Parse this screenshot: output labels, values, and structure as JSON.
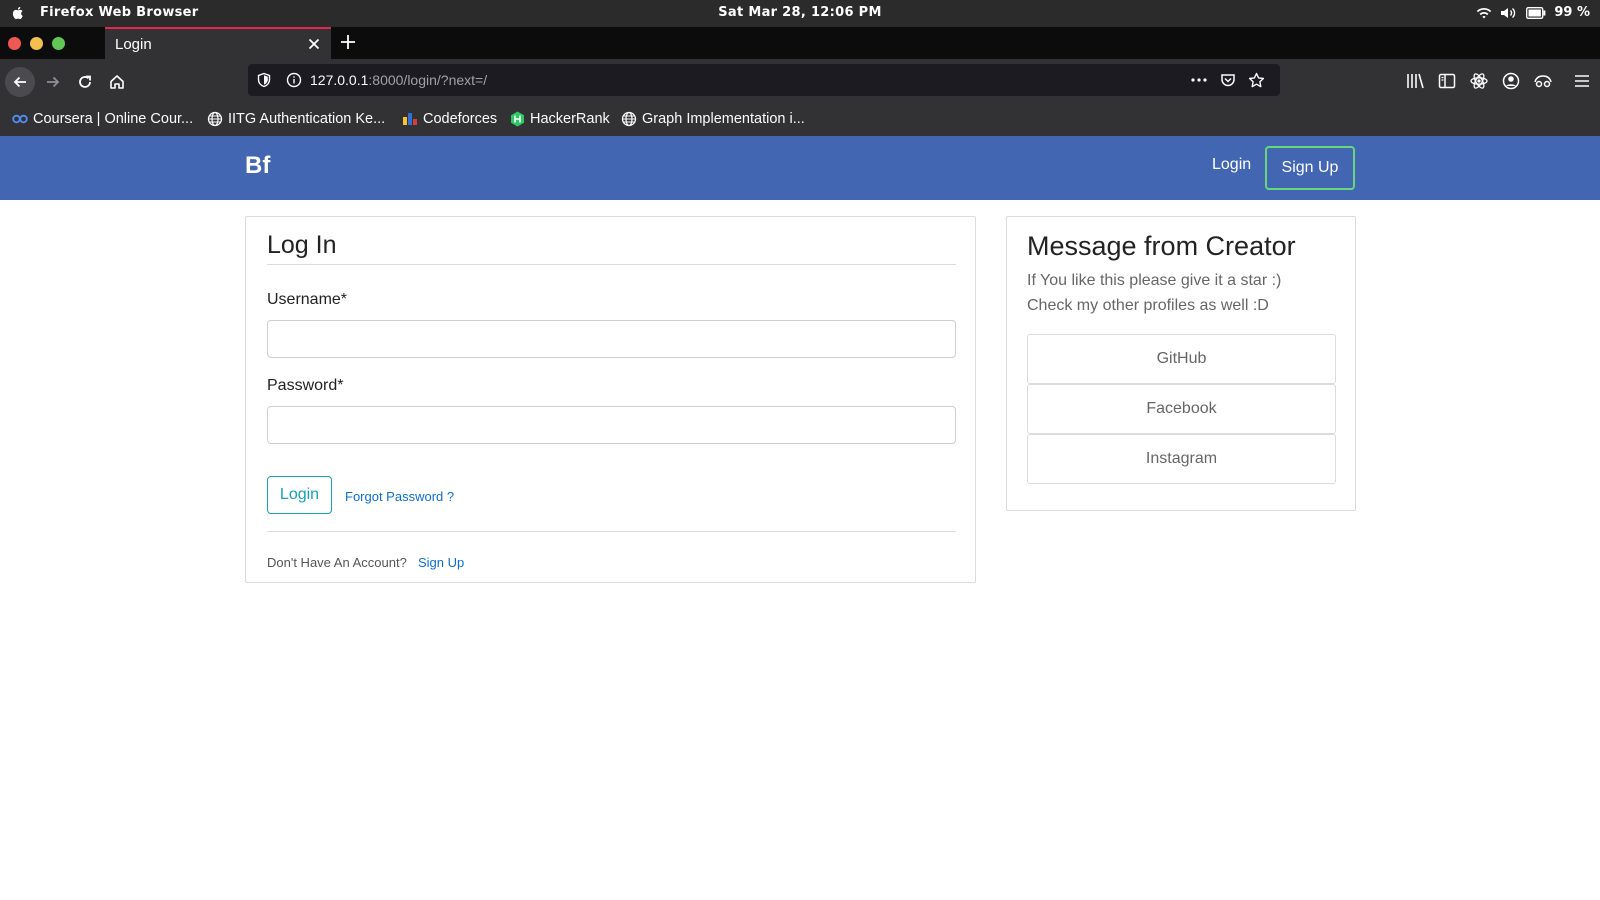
{
  "os": {
    "app_name": "Firefox Web Browser",
    "clock": "Sat Mar 28, 12:06 PM",
    "battery": "99 %"
  },
  "browser": {
    "tab_title": "Login",
    "url_host": "127.0.0.1",
    "url_path": ":8000/login/?next=/",
    "bookmarks": [
      {
        "label": "Coursera | Online Cour...",
        "icon": "coursera-icon"
      },
      {
        "label": "IITG Authentication Ke...",
        "icon": "globe-icon"
      },
      {
        "label": "Codeforces",
        "icon": "codeforces-icon"
      },
      {
        "label": "HackerRank",
        "icon": "hackerrank-icon"
      },
      {
        "label": "Graph Implementation i...",
        "icon": "globe-icon"
      }
    ]
  },
  "site": {
    "brand": "Bf",
    "nav_login": "Login",
    "nav_signup": "Sign Up",
    "accent_color": "#4266b2"
  },
  "login_card": {
    "heading": "Log In",
    "username_label": "Username*",
    "password_label": "Password*",
    "username_value": "",
    "password_value": "",
    "login_button": "Login",
    "forgot_link": "Forgot Password ?",
    "no_account_text": "Don't Have An Account?",
    "signup_link": "Sign Up"
  },
  "message_card": {
    "heading": "Message from Creator",
    "line1": "If You like this please give it a star :)",
    "line2": "Check my other profiles as well :D",
    "profiles": [
      "GitHub",
      "Facebook",
      "Instagram"
    ]
  }
}
